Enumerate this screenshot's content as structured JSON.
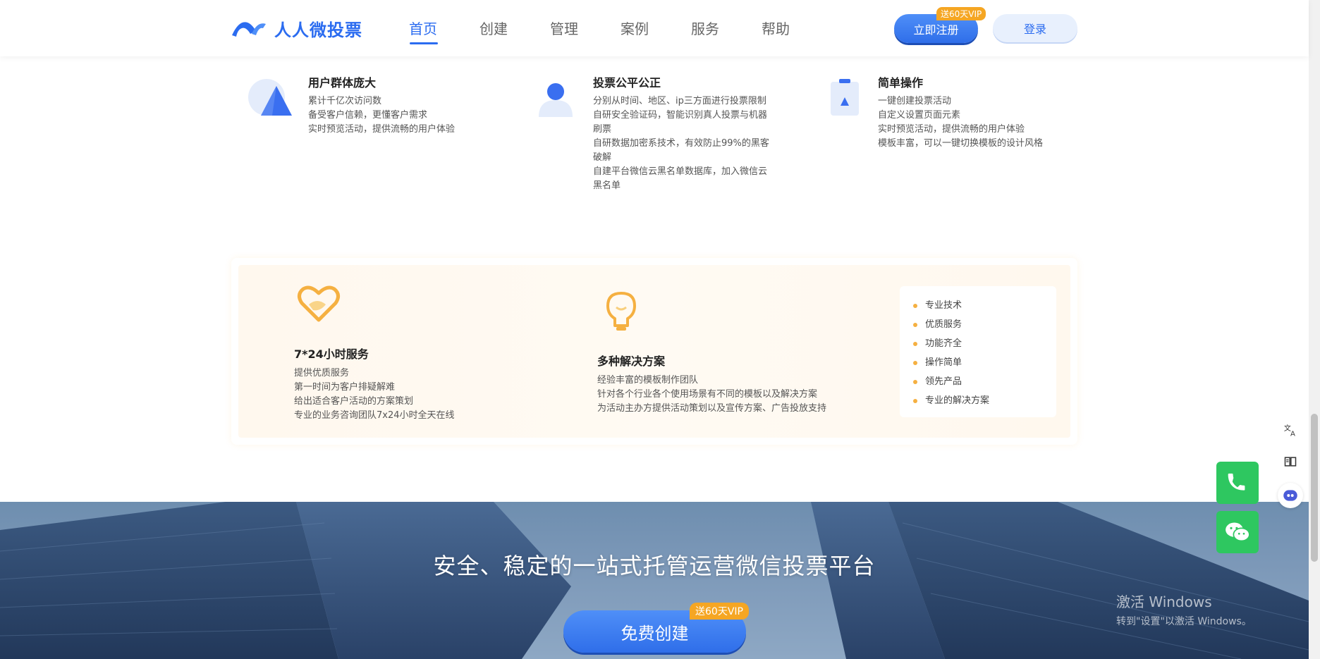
{
  "header": {
    "logo_text": "人人微投票",
    "nav": [
      "首页",
      "创建",
      "管理",
      "案例",
      "服务",
      "帮助"
    ],
    "register_label": "立即注册",
    "register_badge": "送60天VIP",
    "login_label": "登录"
  },
  "features": [
    {
      "title": "用户群体庞大",
      "lines": [
        "累计千亿次访问数",
        "备受客户信赖，更懂客户需求",
        "实时预览活动，提供流畅的用户体验"
      ]
    },
    {
      "title": "投票公平公正",
      "lines": [
        "分别从时间、地区、ip三方面进行投票限制",
        "自研安全验证码，智能识别真人投票与机器刷票",
        "自研数据加密系技术，有效防止99%的黑客破解",
        "自建平台微信云黑名单数据库，加入微信云黑名单"
      ]
    },
    {
      "title": "简单操作",
      "lines": [
        "一键创建投票活动",
        "自定义设置页面元素",
        "实时预览活动，提供流畅的用户体验",
        "模板丰富，可以一键切换模板的设计风格"
      ]
    }
  ],
  "services": [
    {
      "title": "7*24小时服务",
      "lines": [
        "提供优质服务",
        "第一时间为客户排疑解难",
        "给出适合客户活动的方案策划",
        "专业的业务咨询团队7x24小时全天在线"
      ]
    },
    {
      "title": "多种解决方案",
      "lines": [
        "经验丰富的模板制作团队",
        "针对各个行业各个使用场景有不同的模板以及解决方案",
        "为活动主办方提供活动策划以及宣传方案、广告投放支持"
      ]
    }
  ],
  "checklist": [
    "专业技术",
    "优质服务",
    "功能齐全",
    "操作简单",
    "领先产品",
    "专业的解决方案"
  ],
  "banner": {
    "title": "安全、稳定的一站式托管运营微信投票平台",
    "create_label": "免费创建",
    "create_badge": "送60天VIP"
  },
  "watermark": {
    "line1": "激活 Windows",
    "line2": "转到\"设置\"以激活 Windows。"
  },
  "colors": {
    "brand": "#2b6cf0",
    "accent": "#f5a623",
    "green": "#2ec760"
  }
}
